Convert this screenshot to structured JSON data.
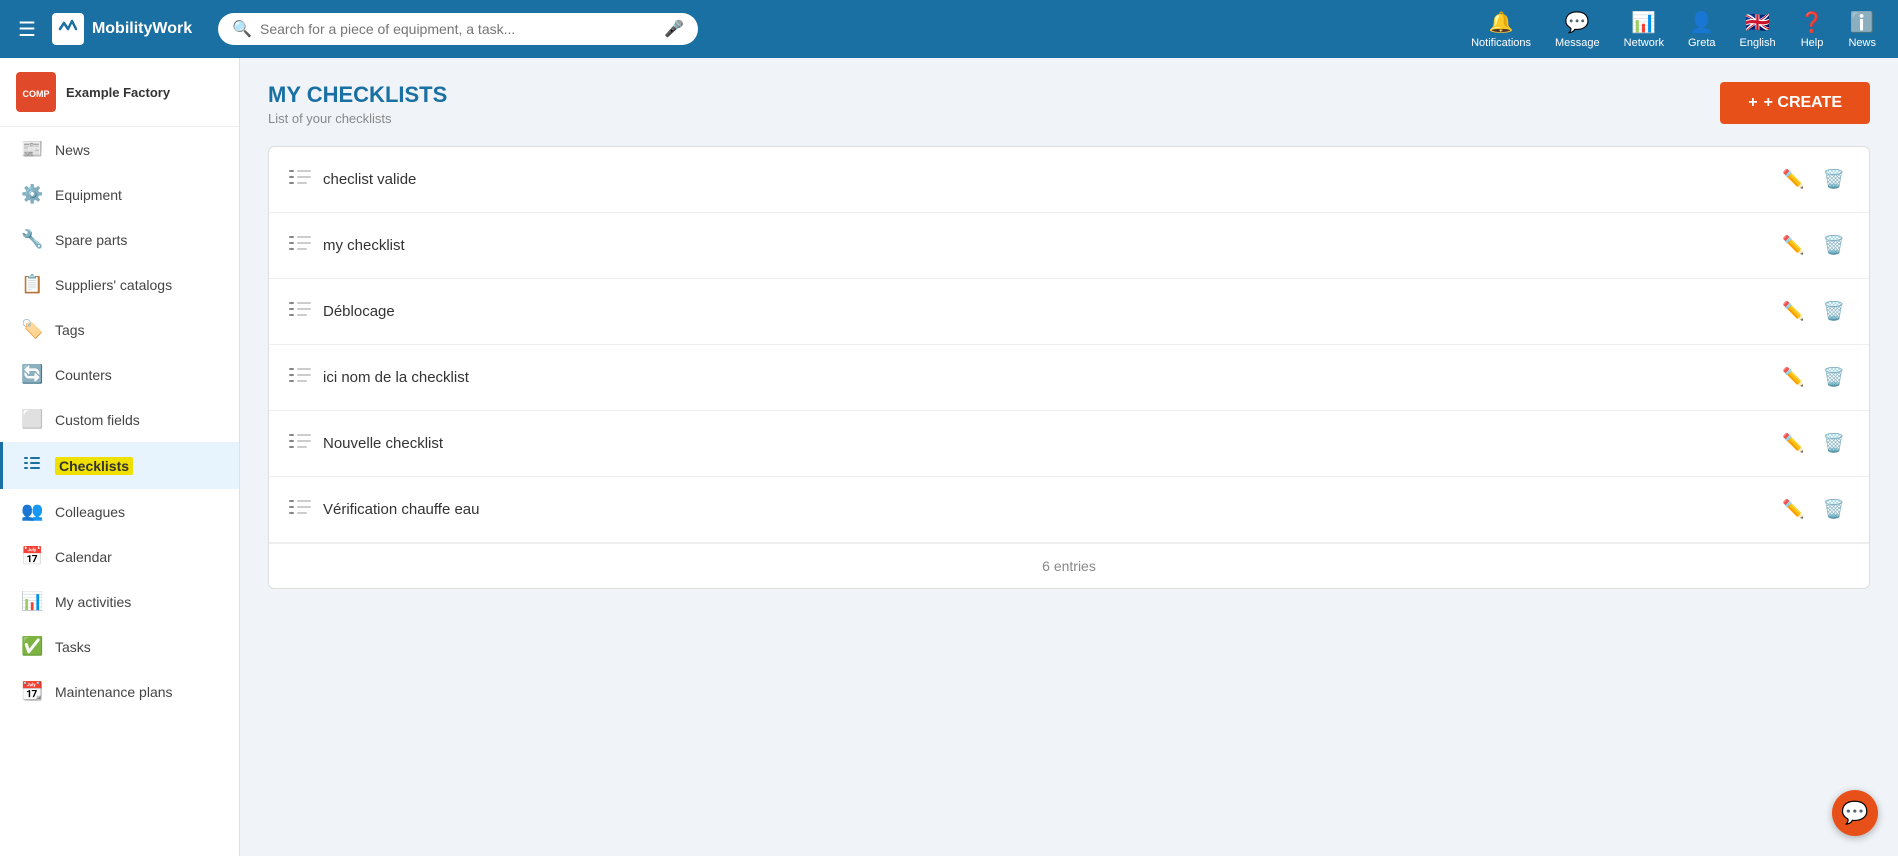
{
  "topnav": {
    "hamburger": "☰",
    "logo_text": "MobilityWork",
    "search_placeholder": "Search for a piece of equipment, a task...",
    "nav_items": [
      {
        "id": "notifications",
        "icon": "🔔",
        "label": "Notifications"
      },
      {
        "id": "message",
        "icon": "💬",
        "label": "Message"
      },
      {
        "id": "network",
        "icon": "📊",
        "label": "Network"
      },
      {
        "id": "greta",
        "icon": "👤",
        "label": "Greta"
      },
      {
        "id": "english",
        "icon": "🇬🇧",
        "label": "English"
      },
      {
        "id": "help",
        "icon": "❓",
        "label": "Help"
      },
      {
        "id": "news",
        "icon": "ℹ️",
        "label": "News"
      }
    ]
  },
  "sidebar": {
    "company_name": "Example Factory",
    "items": [
      {
        "id": "news",
        "icon": "📰",
        "label": "News",
        "active": false
      },
      {
        "id": "equipment",
        "icon": "⚙️",
        "label": "Equipment",
        "active": false
      },
      {
        "id": "spare-parts",
        "icon": "🔧",
        "label": "Spare parts",
        "active": false
      },
      {
        "id": "suppliers-catalogs",
        "icon": "📋",
        "label": "Suppliers' catalogs",
        "active": false
      },
      {
        "id": "tags",
        "icon": "🏷️",
        "label": "Tags",
        "active": false
      },
      {
        "id": "counters",
        "icon": "🔄",
        "label": "Counters",
        "active": false
      },
      {
        "id": "custom-fields",
        "icon": "⬜",
        "label": "Custom fields",
        "active": false
      },
      {
        "id": "checklists",
        "icon": "☰",
        "label": "Checklists",
        "active": true
      },
      {
        "id": "colleagues",
        "icon": "👥",
        "label": "Colleagues",
        "active": false
      },
      {
        "id": "calendar",
        "icon": "📅",
        "label": "Calendar",
        "active": false
      },
      {
        "id": "my-activities",
        "icon": "📊",
        "label": "My activities",
        "active": false
      },
      {
        "id": "tasks",
        "icon": "✅",
        "label": "Tasks",
        "active": false
      },
      {
        "id": "maintenance-plans",
        "icon": "📆",
        "label": "Maintenance plans",
        "active": false
      }
    ]
  },
  "main": {
    "page_title": "MY CHECKLISTS",
    "page_subtitle": "List of your checklists",
    "create_button": "+ CREATE",
    "checklists": [
      {
        "id": 1,
        "name": "checlist valide"
      },
      {
        "id": 2,
        "name": "my checklist"
      },
      {
        "id": 3,
        "name": "Déblocage"
      },
      {
        "id": 4,
        "name": "ici nom de la checklist"
      },
      {
        "id": 5,
        "name": "Nouvelle checklist"
      },
      {
        "id": 6,
        "name": "Vérification chauffe eau"
      }
    ],
    "entries_count": "6 entries"
  }
}
